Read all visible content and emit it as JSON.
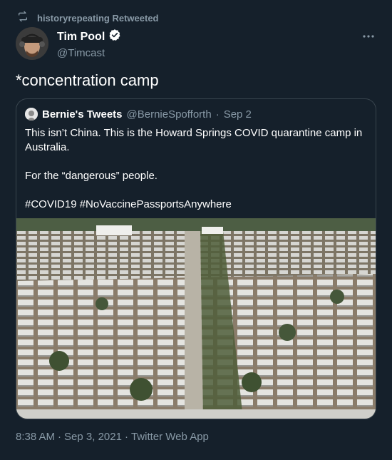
{
  "retweet": {
    "icon": "retweet-icon",
    "text": "historyrepeating Retweeted"
  },
  "tweet": {
    "author_name": "Tim Pool",
    "handle": "@Timcast",
    "text": "*concentration camp",
    "time": "8:38 AM",
    "date": "Sep 3, 2021",
    "source": "Twitter Web App",
    "separator": "·"
  },
  "quote": {
    "author_name": "Bernie's Tweets",
    "handle": "@BernieSpofforth",
    "separator": "·",
    "date": "Sep 2",
    "line1": "This isn’t China. This is the Howard Springs COVID quarantine camp in Australia.",
    "line2": "For the “dangerous” people.",
    "line3": "#COVID19 #NoVaccinePassportsAnywhere"
  },
  "colors": {
    "background": "#15202b",
    "secondary_text": "#8899a6",
    "verified": "#ffffff",
    "border": "#38444d"
  }
}
